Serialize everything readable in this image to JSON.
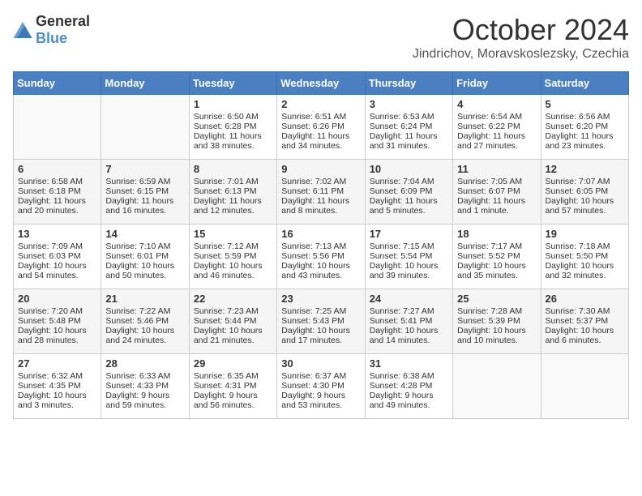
{
  "logo": {
    "text_general": "General",
    "text_blue": "Blue"
  },
  "header": {
    "month": "October 2024",
    "location": "Jindrichov, Moravskoslezsky, Czechia"
  },
  "weekdays": [
    "Sunday",
    "Monday",
    "Tuesday",
    "Wednesday",
    "Thursday",
    "Friday",
    "Saturday"
  ],
  "weeks": [
    [
      {
        "day": "",
        "content": ""
      },
      {
        "day": "",
        "content": ""
      },
      {
        "day": "1",
        "content": "Sunrise: 6:50 AM\nSunset: 6:28 PM\nDaylight: 11 hours and 38 minutes."
      },
      {
        "day": "2",
        "content": "Sunrise: 6:51 AM\nSunset: 6:26 PM\nDaylight: 11 hours and 34 minutes."
      },
      {
        "day": "3",
        "content": "Sunrise: 6:53 AM\nSunset: 6:24 PM\nDaylight: 11 hours and 31 minutes."
      },
      {
        "day": "4",
        "content": "Sunrise: 6:54 AM\nSunset: 6:22 PM\nDaylight: 11 hours and 27 minutes."
      },
      {
        "day": "5",
        "content": "Sunrise: 6:56 AM\nSunset: 6:20 PM\nDaylight: 11 hours and 23 minutes."
      }
    ],
    [
      {
        "day": "6",
        "content": "Sunrise: 6:58 AM\nSunset: 6:18 PM\nDaylight: 11 hours and 20 minutes."
      },
      {
        "day": "7",
        "content": "Sunrise: 6:59 AM\nSunset: 6:15 PM\nDaylight: 11 hours and 16 minutes."
      },
      {
        "day": "8",
        "content": "Sunrise: 7:01 AM\nSunset: 6:13 PM\nDaylight: 11 hours and 12 minutes."
      },
      {
        "day": "9",
        "content": "Sunrise: 7:02 AM\nSunset: 6:11 PM\nDaylight: 11 hours and 8 minutes."
      },
      {
        "day": "10",
        "content": "Sunrise: 7:04 AM\nSunset: 6:09 PM\nDaylight: 11 hours and 5 minutes."
      },
      {
        "day": "11",
        "content": "Sunrise: 7:05 AM\nSunset: 6:07 PM\nDaylight: 11 hours and 1 minute."
      },
      {
        "day": "12",
        "content": "Sunrise: 7:07 AM\nSunset: 6:05 PM\nDaylight: 10 hours and 57 minutes."
      }
    ],
    [
      {
        "day": "13",
        "content": "Sunrise: 7:09 AM\nSunset: 6:03 PM\nDaylight: 10 hours and 54 minutes."
      },
      {
        "day": "14",
        "content": "Sunrise: 7:10 AM\nSunset: 6:01 PM\nDaylight: 10 hours and 50 minutes."
      },
      {
        "day": "15",
        "content": "Sunrise: 7:12 AM\nSunset: 5:59 PM\nDaylight: 10 hours and 46 minutes."
      },
      {
        "day": "16",
        "content": "Sunrise: 7:13 AM\nSunset: 5:56 PM\nDaylight: 10 hours and 43 minutes."
      },
      {
        "day": "17",
        "content": "Sunrise: 7:15 AM\nSunset: 5:54 PM\nDaylight: 10 hours and 39 minutes."
      },
      {
        "day": "18",
        "content": "Sunrise: 7:17 AM\nSunset: 5:52 PM\nDaylight: 10 hours and 35 minutes."
      },
      {
        "day": "19",
        "content": "Sunrise: 7:18 AM\nSunset: 5:50 PM\nDaylight: 10 hours and 32 minutes."
      }
    ],
    [
      {
        "day": "20",
        "content": "Sunrise: 7:20 AM\nSunset: 5:48 PM\nDaylight: 10 hours and 28 minutes."
      },
      {
        "day": "21",
        "content": "Sunrise: 7:22 AM\nSunset: 5:46 PM\nDaylight: 10 hours and 24 minutes."
      },
      {
        "day": "22",
        "content": "Sunrise: 7:23 AM\nSunset: 5:44 PM\nDaylight: 10 hours and 21 minutes."
      },
      {
        "day": "23",
        "content": "Sunrise: 7:25 AM\nSunset: 5:43 PM\nDaylight: 10 hours and 17 minutes."
      },
      {
        "day": "24",
        "content": "Sunrise: 7:27 AM\nSunset: 5:41 PM\nDaylight: 10 hours and 14 minutes."
      },
      {
        "day": "25",
        "content": "Sunrise: 7:28 AM\nSunset: 5:39 PM\nDaylight: 10 hours and 10 minutes."
      },
      {
        "day": "26",
        "content": "Sunrise: 7:30 AM\nSunset: 5:37 PM\nDaylight: 10 hours and 6 minutes."
      }
    ],
    [
      {
        "day": "27",
        "content": "Sunrise: 6:32 AM\nSunset: 4:35 PM\nDaylight: 10 hours and 3 minutes."
      },
      {
        "day": "28",
        "content": "Sunrise: 6:33 AM\nSunset: 4:33 PM\nDaylight: 9 hours and 59 minutes."
      },
      {
        "day": "29",
        "content": "Sunrise: 6:35 AM\nSunset: 4:31 PM\nDaylight: 9 hours and 56 minutes."
      },
      {
        "day": "30",
        "content": "Sunrise: 6:37 AM\nSunset: 4:30 PM\nDaylight: 9 hours and 53 minutes."
      },
      {
        "day": "31",
        "content": "Sunrise: 6:38 AM\nSunset: 4:28 PM\nDaylight: 9 hours and 49 minutes."
      },
      {
        "day": "",
        "content": ""
      },
      {
        "day": "",
        "content": ""
      }
    ]
  ]
}
